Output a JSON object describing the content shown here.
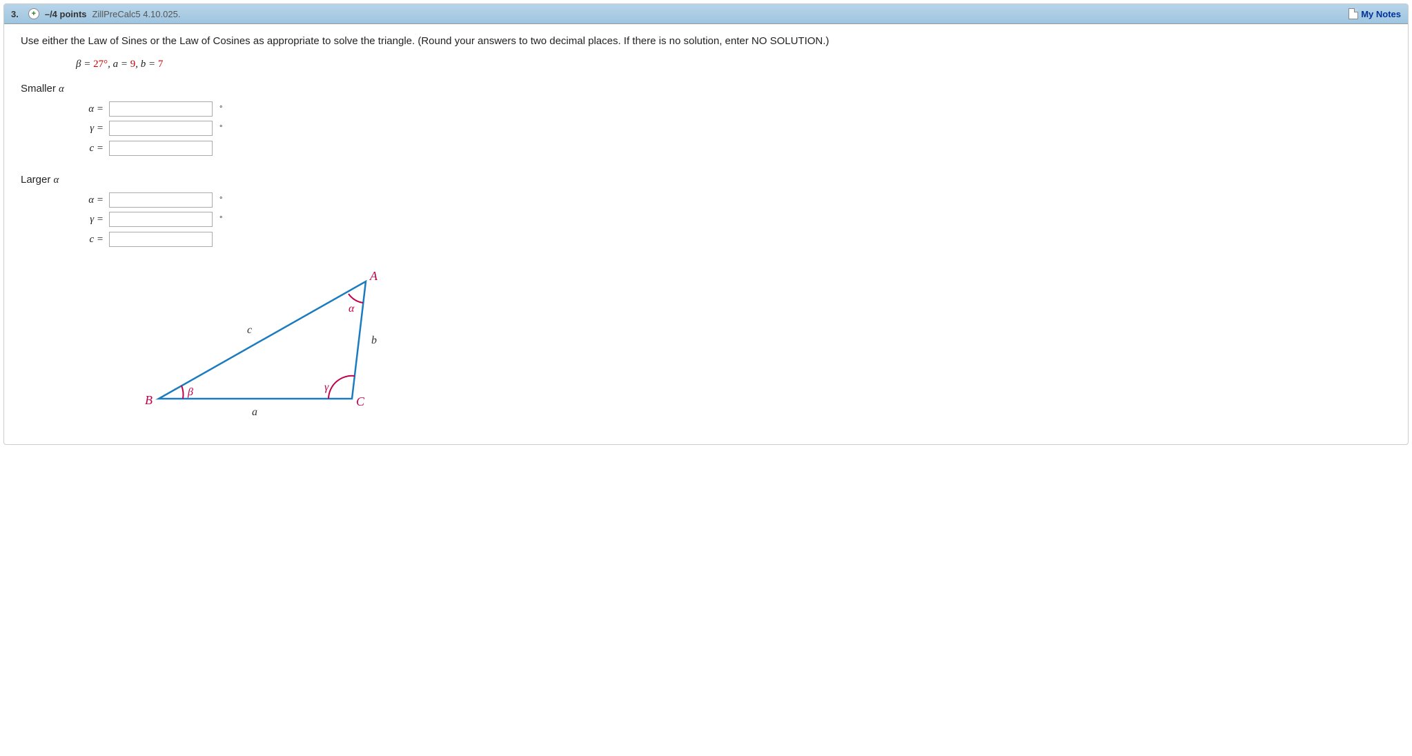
{
  "header": {
    "number": "3.",
    "expand_glyph": "+",
    "points": "–/4 points",
    "reference": "ZillPreCalc5 4.10.025.",
    "my_notes": "My Notes"
  },
  "instructions": "Use either the Law of Sines or the Law of Cosines as appropriate to solve the triangle. (Round your answers to two decimal places. If there is no solution, enter NO SOLUTION.)",
  "given": {
    "beta_lhs": "β =",
    "beta_val": "27°",
    "sep1": ", a =",
    "a_val": "9",
    "sep2": ", b =",
    "b_val": "7"
  },
  "sections": {
    "smaller": {
      "label_prefix": "Smaller ",
      "label_var": "α",
      "rows": {
        "alpha": "α  =",
        "gamma": "γ  =",
        "c": "c  ="
      }
    },
    "larger": {
      "label_prefix": "Larger ",
      "label_var": "α",
      "rows": {
        "alpha": "α  =",
        "gamma": "γ  =",
        "c": "c  ="
      }
    }
  },
  "degree_symbol": "°",
  "triangle": {
    "A": "A",
    "B": "B",
    "C": "C",
    "a": "a",
    "b": "b",
    "c": "c",
    "alpha": "α",
    "beta": "β",
    "gamma": "γ"
  }
}
